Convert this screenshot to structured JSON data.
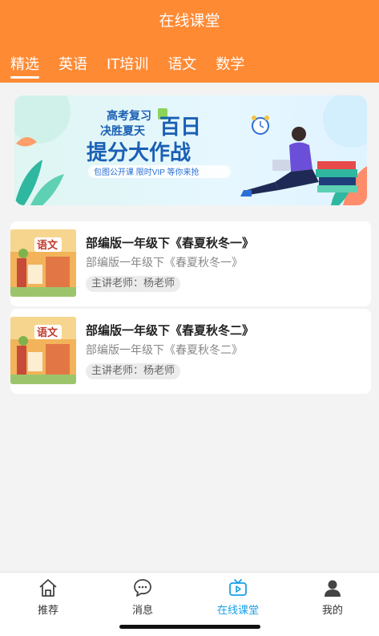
{
  "header": {
    "title": "在线课堂",
    "tabs": [
      {
        "label": "精选",
        "active": true
      },
      {
        "label": "英语",
        "active": false
      },
      {
        "label": "IT培训",
        "active": false
      },
      {
        "label": "语文",
        "active": false
      },
      {
        "label": "数学",
        "active": false
      }
    ]
  },
  "banner": {
    "line1": "高考复习",
    "line2": "决胜夏天",
    "big1": "百日",
    "big2": "提分大作战",
    "sub": "包图公开课 限时VIP 等你来抢"
  },
  "courses": [
    {
      "title": "部编版一年级下《春夏秋冬一》",
      "subtitle": "部编版一年级下《春夏秋冬一》",
      "teacher": "主讲老师：杨老师",
      "thumb_text": "语文"
    },
    {
      "title": "部编版一年级下《春夏秋冬二》",
      "subtitle": "部编版一年级下《春夏秋冬二》",
      "teacher": "主讲老师：杨老师",
      "thumb_text": "语文"
    }
  ],
  "bottom_nav": [
    {
      "label": "推荐",
      "icon": "home-icon",
      "active": false
    },
    {
      "label": "消息",
      "icon": "message-icon",
      "active": false
    },
    {
      "label": "在线课堂",
      "icon": "tv-play-icon",
      "active": true
    },
    {
      "label": "我的",
      "icon": "user-icon",
      "active": false
    }
  ],
  "colors": {
    "header": "#ff8a34",
    "active_nav": "#17a0e6",
    "banner_text": "#1a5fb4"
  }
}
